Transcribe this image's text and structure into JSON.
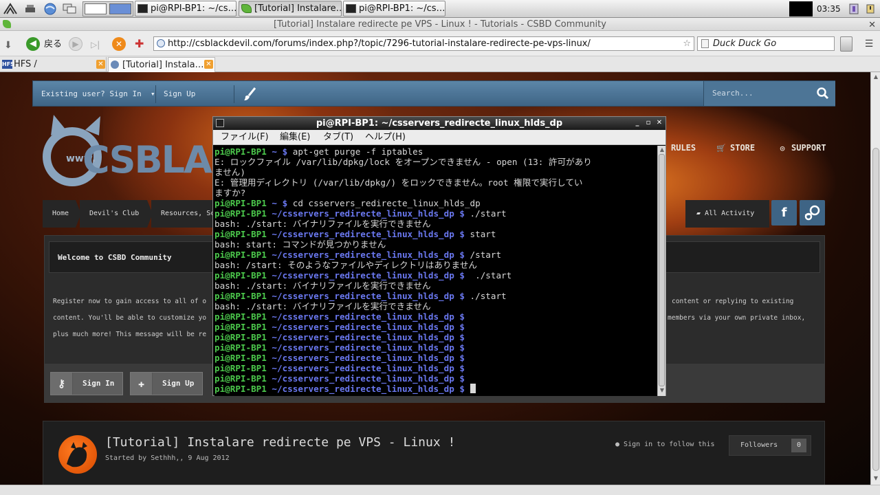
{
  "taskbar": {
    "tasks": [
      {
        "label": "pi@RPI-BP1: ~/cs…"
      },
      {
        "label": "[Tutorial] Instalare…"
      },
      {
        "label": "pi@RPI-BP1: ~/cs…"
      }
    ],
    "clock": "03:35"
  },
  "browser": {
    "window_title": "[Tutorial] Instalare redirecte pe VPS - Linux ! - Tutorials - CSBD Community",
    "back_label": "戻る",
    "url": "http://csblackdevil.com/forums/index.php?/topic/7296-tutorial-instalare-redirecte-pe-vps-linux/",
    "search_engine": "Duck Duck Go",
    "tabs": [
      {
        "label": "HFS /",
        "favicon": "HFS"
      },
      {
        "label": "[Tutorial] Instala…"
      }
    ]
  },
  "site": {
    "userbar": {
      "signin": "Existing user? Sign In",
      "signup": "Sign Up",
      "search_placeholder": "Search..."
    },
    "logo_text": "CSBLAC",
    "logo_www": "www.",
    "nav": {
      "rules": "RULES",
      "store": "STORE",
      "support": "SUPPORT"
    },
    "breadcrumbs": [
      "Home",
      "Devil's Club",
      "Resources, Sc"
    ],
    "all_activity": "All Activity",
    "social": {
      "facebook": "f"
    },
    "welcome": {
      "title": "Welcome to CSBD Community",
      "line1_left": "Register now to gain access to all of o",
      "line1_right": "content or replying to existing",
      "line2_left": "content. You'll be able to customize yo",
      "line2_right": "members via your own private inbox,",
      "line3_left": "plus much more! This message will be re",
      "signin_btn": "Sign In",
      "signup_btn": "Sign Up"
    },
    "topic": {
      "title": "[Tutorial] Instalare redirecte pe VPS - Linux !",
      "meta": "Started by Sethhh,, 9 Aug 2012",
      "follow_hint": "Sign in to follow this",
      "followers_label": "Followers",
      "followers_count": "0"
    }
  },
  "terminal": {
    "title": "pi@RPI-BP1: ~/csservers_redirecte_linux_hlds_dp",
    "menu": [
      "ファイル(F)",
      "編集(E)",
      "タブ(T)",
      "ヘルプ(H)"
    ],
    "prompt_user": "pi@RPI-BP1",
    "lines": [
      {
        "type": "prompt",
        "path": "~",
        "cmd": " apt-get purge -f iptables"
      },
      {
        "type": "out",
        "text": "E: ロックファイル /var/lib/dpkg/lock をオープンできません - open (13: 許可があり"
      },
      {
        "type": "out",
        "text": "ません)"
      },
      {
        "type": "out",
        "text": "E: 管理用ディレクトリ (/var/lib/dpkg/) をロックできません。root 権限で実行してい"
      },
      {
        "type": "out",
        "text": "ますか?"
      },
      {
        "type": "prompt",
        "path": "~",
        "cmd": " cd csservers_redirecte_linux_hlds_dp"
      },
      {
        "type": "prompt",
        "path": "~/csservers_redirecte_linux_hlds_dp",
        "cmd": " ./start"
      },
      {
        "type": "out",
        "text": "bash: ./start: バイナリファイルを実行できません"
      },
      {
        "type": "prompt",
        "path": "~/csservers_redirecte_linux_hlds_dp",
        "cmd": " start"
      },
      {
        "type": "out",
        "text": "bash: start: コマンドが見つかりません"
      },
      {
        "type": "prompt",
        "path": "~/csservers_redirecte_linux_hlds_dp",
        "cmd": " /start"
      },
      {
        "type": "out",
        "text": "bash: /start: そのようなファイルやディレクトリはありません"
      },
      {
        "type": "prompt",
        "path": "~/csservers_redirecte_linux_hlds_dp",
        "cmd": "  ./start"
      },
      {
        "type": "out",
        "text": "bash: ./start: バイナリファイルを実行できません"
      },
      {
        "type": "prompt",
        "path": "~/csservers_redirecte_linux_hlds_dp",
        "cmd": " ./start"
      },
      {
        "type": "out",
        "text": "bash: ./start: バイナリファイルを実行できません"
      },
      {
        "type": "prompt",
        "path": "~/csservers_redirecte_linux_hlds_dp",
        "cmd": ""
      },
      {
        "type": "prompt",
        "path": "~/csservers_redirecte_linux_hlds_dp",
        "cmd": ""
      },
      {
        "type": "prompt",
        "path": "~/csservers_redirecte_linux_hlds_dp",
        "cmd": ""
      },
      {
        "type": "prompt",
        "path": "~/csservers_redirecte_linux_hlds_dp",
        "cmd": ""
      },
      {
        "type": "prompt",
        "path": "~/csservers_redirecte_linux_hlds_dp",
        "cmd": ""
      },
      {
        "type": "prompt",
        "path": "~/csservers_redirecte_linux_hlds_dp",
        "cmd": ""
      },
      {
        "type": "prompt",
        "path": "~/csservers_redirecte_linux_hlds_dp",
        "cmd": ""
      },
      {
        "type": "prompt",
        "path": "~/csservers_redirecte_linux_hlds_dp",
        "cmd": "",
        "cursor": true
      }
    ]
  },
  "colors": {
    "prompt_user": "#4cc94c",
    "prompt_path": "#6a78f0",
    "site_bar": "#3e6485"
  }
}
